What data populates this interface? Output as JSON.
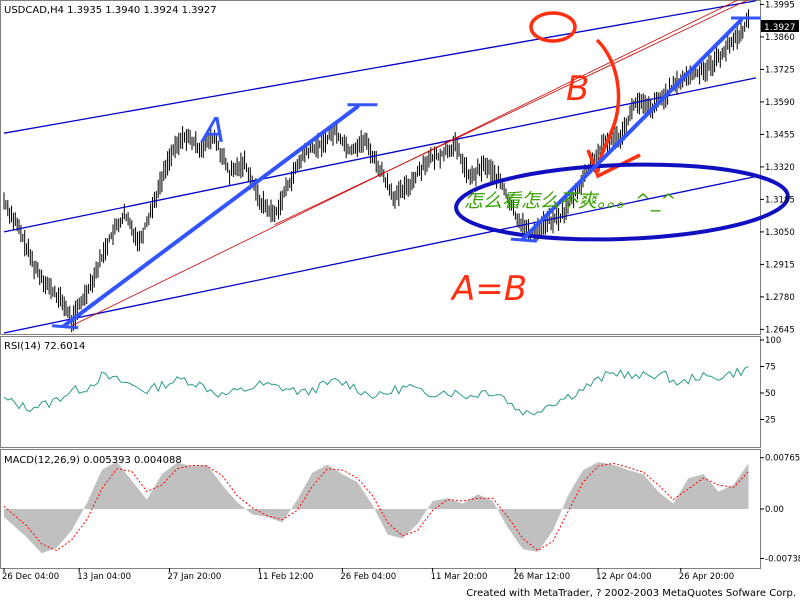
{
  "app": {
    "symbol_header": "USDCAD,H4  1.3935 1.3940 1.3924 1.3927",
    "footer": "Created with MetaTrader, ? 2002-2003 MetaQuotes Sofware Corp."
  },
  "colors": {
    "background": "#ffffff",
    "candles": "#000000",
    "channel": "#0000cc",
    "annotation_blue": "#3355ff",
    "annotation_red": "#ff3010",
    "thin_red": "#cc0000",
    "rsi_line": "#2a9a8c",
    "macd_hist": "#c0c0c0",
    "macd_signal": "#ff0000",
    "green_text": "#3aa000",
    "price_label_bg": "#000000"
  },
  "chart_data": [
    {
      "type": "line",
      "name": "price",
      "title": "USDCAD,H4",
      "ohlc_last": {
        "open": 1.3935,
        "high": 1.394,
        "low": 1.3924,
        "close": 1.3927
      },
      "yticks": [
        1.3995,
        1.386,
        1.3725,
        1.359,
        1.3455,
        1.332,
        1.3185,
        1.305,
        1.2915,
        1.278,
        1.2645
      ],
      "ylim": [
        1.263,
        1.4005
      ],
      "current_price_label": "1.3927",
      "x_index_range": [
        0,
        100
      ],
      "xticks": [
        {
          "i": 0,
          "label": "26 Dec 04:00"
        },
        {
          "i": 10,
          "label": "13 Jan 04:00"
        },
        {
          "i": 22,
          "label": "27 Jan 20:00"
        },
        {
          "i": 34,
          "label": "11 Feb 12:00"
        },
        {
          "i": 45,
          "label": "26 Feb 04:00"
        },
        {
          "i": 57,
          "label": "11 Mar 20:00"
        },
        {
          "i": 68,
          "label": "26 Mar 12:00"
        },
        {
          "i": 79,
          "label": "12 Apr 04:00"
        },
        {
          "i": 90,
          "label": "26 Apr 20:00"
        }
      ],
      "series_points": [
        [
          0,
          1.318
        ],
        [
          2,
          1.306
        ],
        [
          4,
          1.291
        ],
        [
          6,
          1.282
        ],
        [
          8,
          1.275
        ],
        [
          9,
          1.268
        ],
        [
          10,
          1.274
        ],
        [
          12,
          1.287
        ],
        [
          14,
          1.302
        ],
        [
          16,
          1.312
        ],
        [
          18,
          1.301
        ],
        [
          20,
          1.318
        ],
        [
          22,
          1.336
        ],
        [
          24,
          1.345
        ],
        [
          26,
          1.34
        ],
        [
          28,
          1.344
        ],
        [
          30,
          1.329
        ],
        [
          32,
          1.334
        ],
        [
          34,
          1.318
        ],
        [
          36,
          1.312
        ],
        [
          38,
          1.326
        ],
        [
          40,
          1.338
        ],
        [
          42,
          1.341
        ],
        [
          44,
          1.347
        ],
        [
          46,
          1.339
        ],
        [
          48,
          1.343
        ],
        [
          50,
          1.331
        ],
        [
          52,
          1.319
        ],
        [
          54,
          1.325
        ],
        [
          56,
          1.334
        ],
        [
          58,
          1.337
        ],
        [
          60,
          1.341
        ],
        [
          62,
          1.327
        ],
        [
          64,
          1.333
        ],
        [
          66,
          1.326
        ],
        [
          68,
          1.312
        ],
        [
          70,
          1.304
        ],
        [
          72,
          1.309
        ],
        [
          74,
          1.311
        ],
        [
          76,
          1.321
        ],
        [
          78,
          1.333
        ],
        [
          80,
          1.342
        ],
        [
          82,
          1.345
        ],
        [
          84,
          1.359
        ],
        [
          86,
          1.356
        ],
        [
          88,
          1.362
        ],
        [
          90,
          1.368
        ],
        [
          92,
          1.371
        ],
        [
          94,
          1.374
        ],
        [
          96,
          1.381
        ],
        [
          98,
          1.388
        ],
        [
          99,
          1.393
        ]
      ],
      "channel_lines": [
        [
          [
            0,
            1.346
          ],
          [
            100,
            1.401
          ]
        ],
        [
          [
            0,
            1.305
          ],
          [
            100,
            1.369
          ]
        ],
        [
          [
            0,
            1.263
          ],
          [
            100,
            1.328
          ]
        ]
      ],
      "thin_red_lines": [
        [
          [
            9,
            1.266
          ],
          [
            98,
            1.402
          ]
        ],
        [
          [
            36,
            1.308
          ],
          [
            100,
            1.403
          ]
        ]
      ],
      "annotations": [
        {
          "label": "A",
          "from": [
            8,
            1.266
          ],
          "to": [
            47,
            1.357
          ]
        },
        {
          "label": "B",
          "from": [
            69,
            1.302
          ],
          "to": [
            98,
            1.393
          ]
        },
        {
          "label": "A=B"
        },
        {
          "label": "怎么看怎么不爽。。。^_^"
        }
      ]
    },
    {
      "type": "line",
      "name": "rsi",
      "title": "RSI(14) 72.6014",
      "yticks": [
        100,
        75,
        50,
        25,
        0
      ],
      "ylim": [
        0,
        100
      ],
      "series_points": [
        [
          0,
          44
        ],
        [
          3,
          36
        ],
        [
          6,
          40
        ],
        [
          9,
          52
        ],
        [
          11,
          55
        ],
        [
          13,
          66
        ],
        [
          16,
          60
        ],
        [
          19,
          52
        ],
        [
          22,
          60
        ],
        [
          24,
          63
        ],
        [
          26,
          58
        ],
        [
          29,
          48
        ],
        [
          32,
          53
        ],
        [
          34,
          58
        ],
        [
          37,
          55
        ],
        [
          40,
          50
        ],
        [
          42,
          56
        ],
        [
          44,
          61
        ],
        [
          46,
          58
        ],
        [
          48,
          50
        ],
        [
          50,
          47
        ],
        [
          52,
          53
        ],
        [
          54,
          56
        ],
        [
          56,
          48
        ],
        [
          58,
          52
        ],
        [
          60,
          50
        ],
        [
          62,
          47
        ],
        [
          64,
          52
        ],
        [
          66,
          49
        ],
        [
          68,
          36
        ],
        [
          70,
          30
        ],
        [
          72,
          38
        ],
        [
          74,
          44
        ],
        [
          76,
          50
        ],
        [
          78,
          58
        ],
        [
          80,
          66
        ],
        [
          82,
          70
        ],
        [
          84,
          64
        ],
        [
          86,
          68
        ],
        [
          88,
          66
        ],
        [
          90,
          58
        ],
        [
          92,
          66
        ],
        [
          94,
          64
        ],
        [
          96,
          67
        ],
        [
          99,
          72.6
        ]
      ]
    },
    {
      "type": "bar",
      "name": "macd",
      "title": "MACD(12,26,9) 0.005393 0.004088",
      "yticks": [
        0.00765,
        0.0,
        -0.00738
      ],
      "ylim": [
        -0.0085,
        0.0085
      ],
      "histogram_points": [
        [
          0,
          -0.0012
        ],
        [
          3,
          -0.0042
        ],
        [
          5,
          -0.0066
        ],
        [
          7,
          -0.0058
        ],
        [
          9,
          -0.0032
        ],
        [
          11,
          0.0008
        ],
        [
          13,
          0.0058
        ],
        [
          15,
          0.0071
        ],
        [
          17,
          0.0042
        ],
        [
          19,
          0.0014
        ],
        [
          21,
          0.0052
        ],
        [
          23,
          0.0069
        ],
        [
          25,
          0.0064
        ],
        [
          27,
          0.0066
        ],
        [
          29,
          0.0036
        ],
        [
          31,
          0.001
        ],
        [
          33,
          -0.0008
        ],
        [
          35,
          -0.0012
        ],
        [
          37,
          -0.002
        ],
        [
          39,
          0.0014
        ],
        [
          41,
          0.0054
        ],
        [
          43,
          0.0066
        ],
        [
          45,
          0.0052
        ],
        [
          47,
          0.004
        ],
        [
          49,
          0.0006
        ],
        [
          51,
          -0.0038
        ],
        [
          53,
          -0.0044
        ],
        [
          55,
          -0.0022
        ],
        [
          57,
          0.0012
        ],
        [
          59,
          0.0016
        ],
        [
          61,
          0.0008
        ],
        [
          63,
          0.0022
        ],
        [
          65,
          0.0012
        ],
        [
          67,
          -0.0028
        ],
        [
          69,
          -0.006
        ],
        [
          71,
          -0.0064
        ],
        [
          73,
          -0.0032
        ],
        [
          75,
          0.002
        ],
        [
          77,
          0.0058
        ],
        [
          79,
          0.007
        ],
        [
          81,
          0.0066
        ],
        [
          83,
          0.0058
        ],
        [
          85,
          0.0052
        ],
        [
          87,
          0.0026
        ],
        [
          89,
          0.0008
        ],
        [
          91,
          0.0046
        ],
        [
          93,
          0.0052
        ],
        [
          95,
          0.0026
        ],
        [
          97,
          0.0036
        ],
        [
          99,
          0.0068
        ]
      ],
      "signal_points": [
        [
          0,
          0.0004
        ],
        [
          3,
          -0.0025
        ],
        [
          5,
          -0.0052
        ],
        [
          7,
          -0.0062
        ],
        [
          9,
          -0.0046
        ],
        [
          11,
          -0.0016
        ],
        [
          13,
          0.003
        ],
        [
          15,
          0.006
        ],
        [
          17,
          0.0056
        ],
        [
          19,
          0.0026
        ],
        [
          21,
          0.0036
        ],
        [
          23,
          0.006
        ],
        [
          25,
          0.0065
        ],
        [
          27,
          0.0064
        ],
        [
          29,
          0.005
        ],
        [
          31,
          0.002
        ],
        [
          33,
          0.0002
        ],
        [
          35,
          -0.001
        ],
        [
          37,
          -0.0016
        ],
        [
          39,
          -0.0002
        ],
        [
          41,
          0.0034
        ],
        [
          43,
          0.006
        ],
        [
          45,
          0.0058
        ],
        [
          47,
          0.0046
        ],
        [
          49,
          0.002
        ],
        [
          51,
          -0.002
        ],
        [
          53,
          -0.004
        ],
        [
          55,
          -0.0032
        ],
        [
          57,
          -0.0002
        ],
        [
          59,
          0.0014
        ],
        [
          61,
          0.0012
        ],
        [
          63,
          0.0016
        ],
        [
          65,
          0.0016
        ],
        [
          67,
          -0.0012
        ],
        [
          69,
          -0.0044
        ],
        [
          71,
          -0.0062
        ],
        [
          73,
          -0.0048
        ],
        [
          75,
          -0.0004
        ],
        [
          77,
          0.004
        ],
        [
          79,
          0.0064
        ],
        [
          81,
          0.0068
        ],
        [
          83,
          0.0062
        ],
        [
          85,
          0.0055
        ],
        [
          87,
          0.0036
        ],
        [
          89,
          0.0014
        ],
        [
          91,
          0.003
        ],
        [
          93,
          0.0046
        ],
        [
          95,
          0.0036
        ],
        [
          97,
          0.0032
        ],
        [
          99,
          0.0056
        ]
      ]
    }
  ]
}
